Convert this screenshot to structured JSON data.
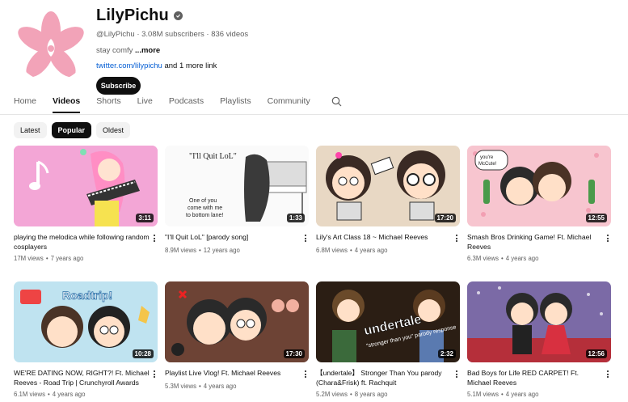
{
  "channel": {
    "name": "LilyPichu",
    "handle": "@LilyPichu",
    "subscribers": "3.08M subscribers",
    "videos_count": "836 videos",
    "description": "stay comfy",
    "more_label": "...more",
    "link_text": "twitter.com/lilypichu",
    "link_more": "and 1 more link",
    "subscribe_label": "Subscribe",
    "avatar_color": "#f2a3b8"
  },
  "tabs": [
    "Home",
    "Videos",
    "Shorts",
    "Live",
    "Podcasts",
    "Playlists",
    "Community"
  ],
  "active_tab": "Videos",
  "chips": [
    "Latest",
    "Popular",
    "Oldest"
  ],
  "active_chip": "Popular",
  "videos": [
    {
      "title": "playing the melodica while following random cosplayers",
      "views": "17M views",
      "age": "7 years ago",
      "duration": "3:11"
    },
    {
      "title": "\"I'll Quit LoL\" [parody song]",
      "views": "8.9M views",
      "age": "12 years ago",
      "duration": "1:33",
      "thumb_text_1": "\"I'll Quit LoL\"",
      "thumb_text_2": "One of you come with me to bottom lane!"
    },
    {
      "title": "Lily's Art Class 18 ~ Michael Reeves",
      "views": "6.8M views",
      "age": "4 years ago",
      "duration": "17:20"
    },
    {
      "title": "Smash Bros Drinking Game! Ft. Michael Reeves",
      "views": "6.3M views",
      "age": "4 years ago",
      "duration": "12:55",
      "thumb_text_1": "you're McCute!"
    },
    {
      "title": "WE'RE DATING NOW, RIGHT?! Ft. Michael Reeves - Road Trip | Crunchyroll Awards",
      "views": "6.1M views",
      "age": "4 years ago",
      "duration": "10:28",
      "thumb_text_1": "Roadtrip!"
    },
    {
      "title": "Playlist Live Vlog! Ft. Michael Reeves",
      "views": "5.3M views",
      "age": "4 years ago",
      "duration": "17:30"
    },
    {
      "title": "【undertale】 Stronger Than You parody (Chara&Frisk) ft. Rachquit",
      "views": "5.2M views",
      "age": "8 years ago",
      "duration": "2:32",
      "thumb_text_1": "undertale",
      "thumb_text_2": "\"stronger than you\" parody response"
    },
    {
      "title": "Bad Boys for Life RED CARPET! Ft. Michael Reeves",
      "views": "5.1M views",
      "age": "4 years ago",
      "duration": "12:56"
    }
  ],
  "icons": {
    "verified": "check-circle-icon",
    "search": "search-icon",
    "more": "kebab-menu-icon"
  }
}
